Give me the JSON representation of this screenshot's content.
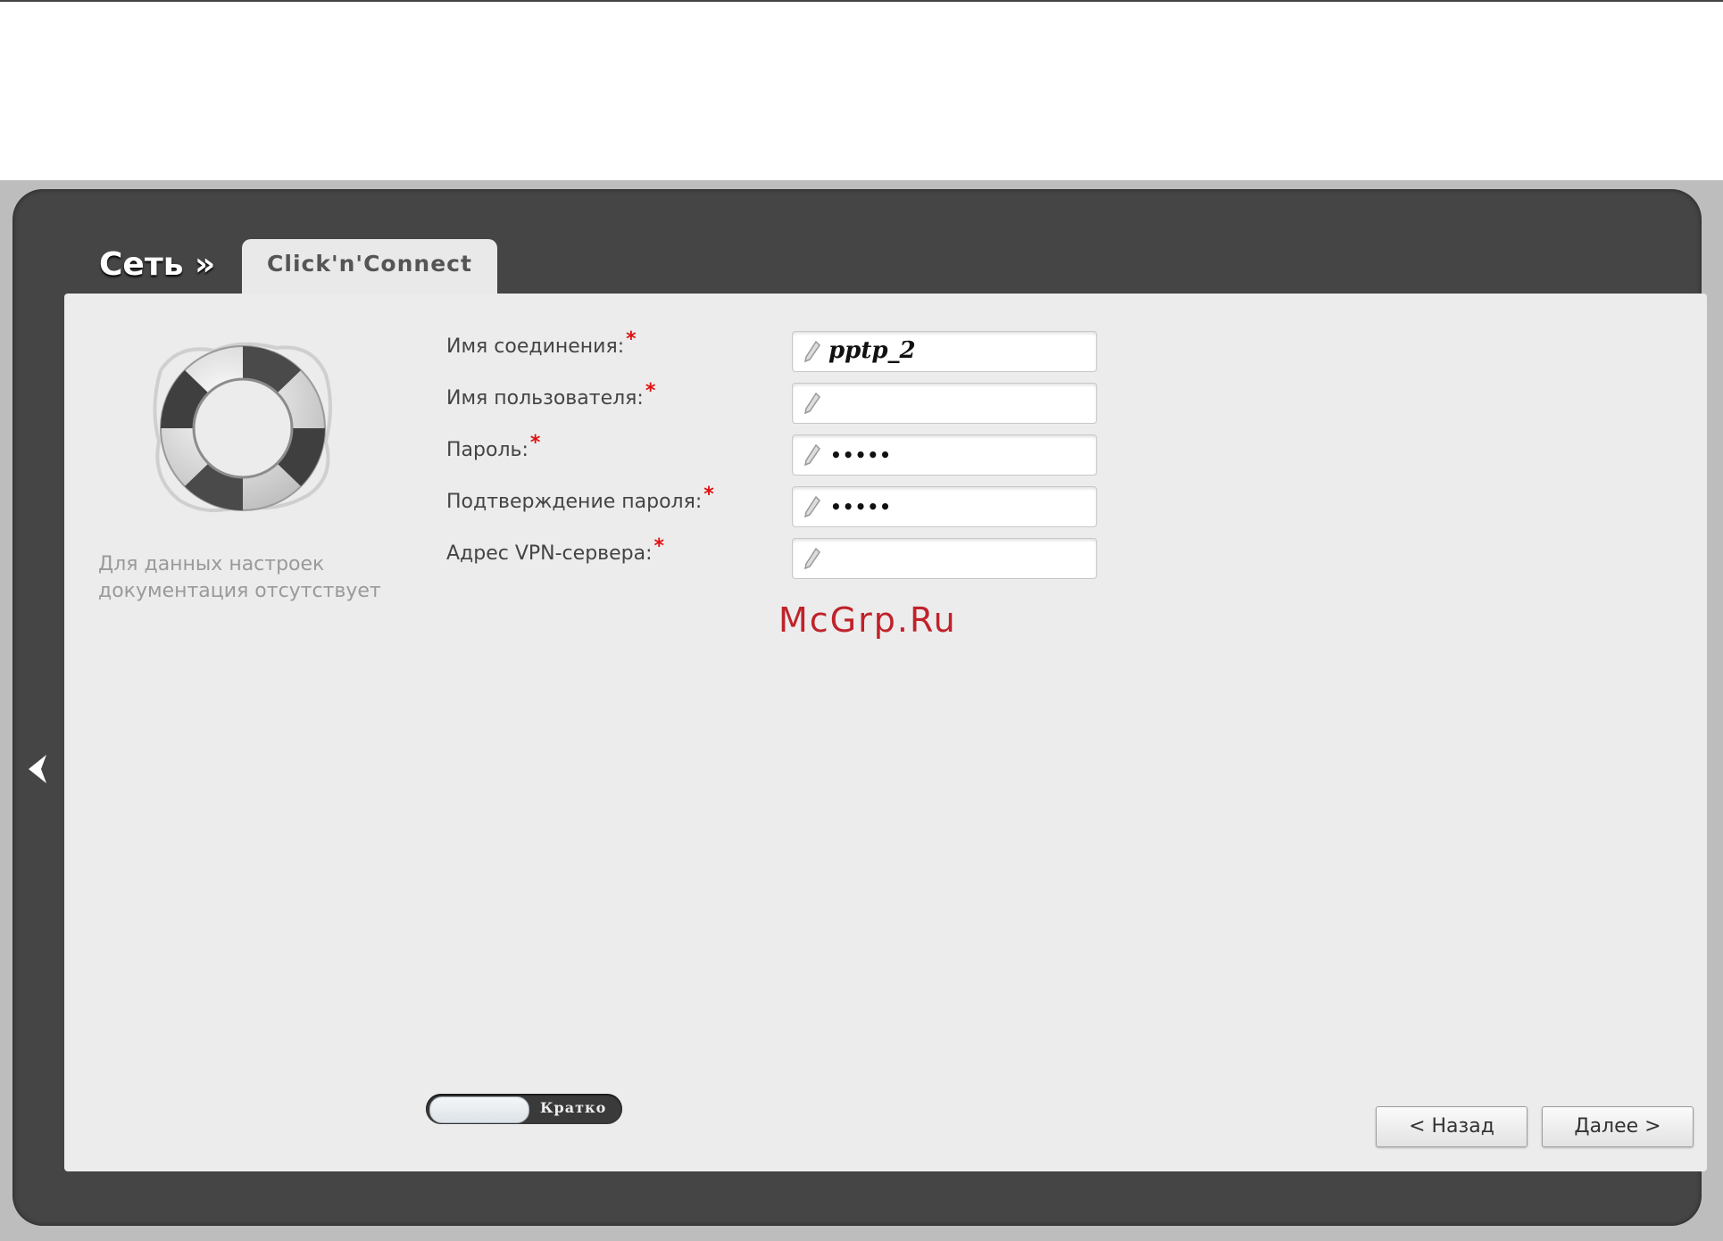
{
  "header": {
    "section_title": "Сеть »",
    "tab_label": "Click'n'Connect"
  },
  "help": {
    "icon": "lifebuoy-icon",
    "note": "Для данных настроек документация отсутствует"
  },
  "form": {
    "connection_name_label": "Имя соединения:",
    "connection_name_value": "pptp_2",
    "username_label": "Имя пользователя:",
    "username_value": "",
    "password_label": "Пароль:",
    "password_value": "•••••",
    "password_confirm_label": "Подтверждение пароля:",
    "password_confirm_value": "•••••",
    "vpn_server_label": "Адрес VPN-сервера:",
    "vpn_server_value": "",
    "required_marker": "*"
  },
  "watermark": "McGrp.Ru",
  "footer": {
    "mode_toggle_label": "Кратко",
    "back_button": "< Назад",
    "next_button": "Далее >"
  },
  "colors": {
    "frame": "#454545",
    "panel": "#ececec",
    "required": "#e01010",
    "watermark": "#c0222a"
  }
}
